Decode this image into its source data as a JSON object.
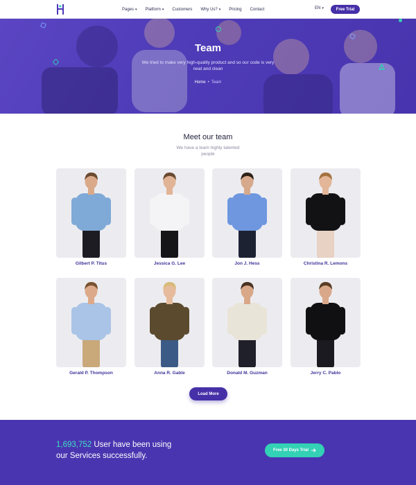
{
  "nav": {
    "items": [
      {
        "label": "Pages",
        "dropdown": true
      },
      {
        "label": "Platform",
        "dropdown": true
      },
      {
        "label": "Customers",
        "dropdown": false
      },
      {
        "label": "Why Us?",
        "dropdown": true
      },
      {
        "label": "Pricing",
        "dropdown": false
      },
      {
        "label": "Contact",
        "dropdown": false
      }
    ],
    "language": "EN",
    "trial_button": "Free Trial"
  },
  "hero": {
    "title": "Team",
    "subtitle": "We tried to make very high-quality product and so our code is very neat and clean",
    "breadcrumb": {
      "home": "Home",
      "separator": "•",
      "current": "Team"
    }
  },
  "team": {
    "title": "Meet our team",
    "subtitle": "We have a team highly talented people",
    "members": [
      {
        "name": "Gilbert P. Titus",
        "shirt": "#7fa9d6",
        "pants": "#1c1c22",
        "skin": "#d9a98a",
        "hair": "#6b4a2f"
      },
      {
        "name": "Jessica G. Lee",
        "shirt": "#f4f4f6",
        "pants": "#151518",
        "skin": "#e1b496",
        "hair": "#6a4a30"
      },
      {
        "name": "Jon J. Hess",
        "shirt": "#6f97e0",
        "pants": "#1d2233",
        "skin": "#d7a98c",
        "hair": "#2e2218"
      },
      {
        "name": "Christina R. Lemons",
        "shirt": "#121214",
        "pants": "#e8d2c4",
        "skin": "#e3b699",
        "hair": "#a5713f"
      },
      {
        "name": "Gerald P. Thompson",
        "shirt": "#a9c4e6",
        "pants": "#c9a87a",
        "skin": "#dcaa8b",
        "hair": "#7a5332"
      },
      {
        "name": "Anna R. Gable",
        "shirt": "#5b4a2e",
        "pants": "#3b5b86",
        "skin": "#e6bb9c",
        "hair": "#d8bb7a"
      },
      {
        "name": "Donald M. Guzman",
        "shirt": "#e9e4d8",
        "pants": "#20202a",
        "skin": "#d8a889",
        "hair": "#4a3322"
      },
      {
        "name": "Jerry C. Pablo",
        "shirt": "#101012",
        "pants": "#1a1a20",
        "skin": "#d9a88a",
        "hair": "#5a3d25"
      }
    ],
    "load_more": "Load More"
  },
  "cta": {
    "count": "1,693,752",
    "text_line1_rest": " User have been using",
    "text_line2": "our Services successfully.",
    "button": "Free 30 Days Trial",
    "button_icon": "arrow-right-icon"
  },
  "colors": {
    "primary": "#4630a8",
    "accent": "#33d1b5",
    "name_text": "#3d3399"
  }
}
